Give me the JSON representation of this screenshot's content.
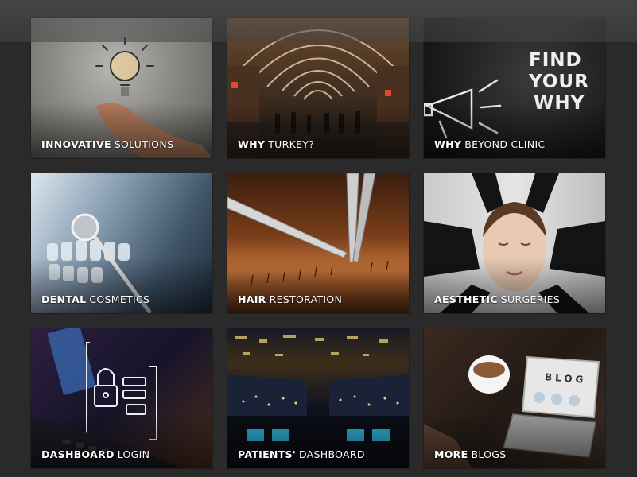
{
  "tiles": [
    {
      "strong": "INNOVATIVE",
      "light": "SOLUTIONS",
      "icon": "lightbulb-icon"
    },
    {
      "strong": "WHY",
      "light": "TURKEY?",
      "icon": "bazaar-image"
    },
    {
      "strong": "WHY",
      "light": "BEYOND CLINIC",
      "icon": "megaphone-icon",
      "chalk_text": [
        "FIND",
        "YOUR",
        "WHY"
      ]
    },
    {
      "strong": "DENTAL",
      "light": "COSMETICS",
      "icon": "tooth-mirror-icon"
    },
    {
      "strong": "HAIR",
      "light": "RESTORATION",
      "icon": "tweezers-icon"
    },
    {
      "strong": "AESTHETIC",
      "light": "SURGERIES",
      "icon": "face-icon"
    },
    {
      "strong": "DASHBOARD",
      "light": "LOGIN",
      "icon": "padlock-icon"
    },
    {
      "strong": "PATIENTS'",
      "light": "DASHBOARD",
      "icon": "cockpit-icon"
    },
    {
      "strong": "MORE",
      "light": "BLOGS",
      "icon": "laptop-icon",
      "screen_text": "BLOG"
    }
  ]
}
